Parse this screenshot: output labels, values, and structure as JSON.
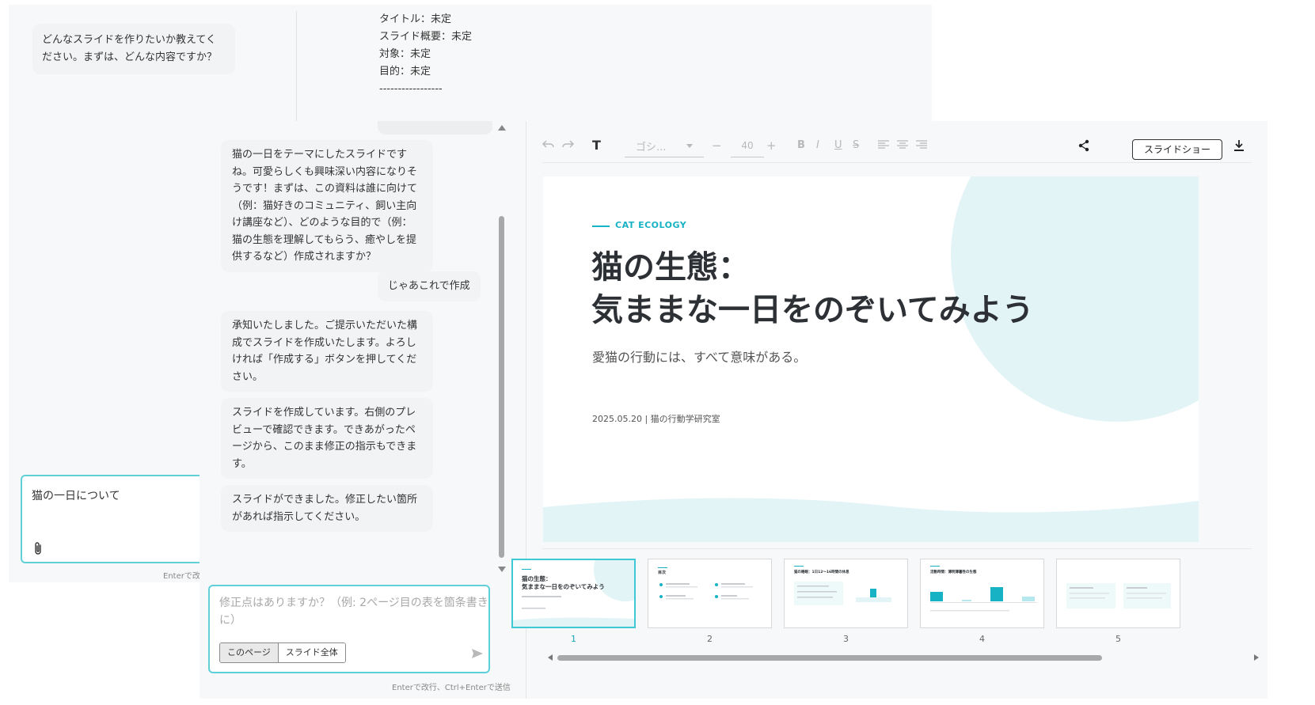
{
  "back_window": {
    "bubble_text": "どんなスライドを作りたいか教えてください。まずは、どんな内容ですか？",
    "info_lines": [
      "タイトル：未定",
      "スライド概要：未定",
      "対象：未定",
      "目的：未定",
      "-----------------"
    ],
    "input_value": "猫の一日について",
    "hint": "Enterで改"
  },
  "chat": {
    "messages": [
      {
        "role": "ai",
        "text": "猫の一日をテーマにしたスライドですね。可愛らしくも興味深い内容になりそうです！まずは、この資料は誰に向けて（例：猫好きのコミュニティ、飼い主向け講座など）、どのような目的で（例：猫の生態を理解してもらう、癒やしを提供するなど）作成されますか？"
      },
      {
        "role": "user",
        "text": "じゃあこれで作成"
      },
      {
        "role": "ai",
        "text": "承知いたしました。ご提示いただいた構成でスライドを作成いたします。よろしければ「作成する」ボタンを押してください。"
      },
      {
        "role": "ai",
        "text": "スライドを作成しています。右側のプレビューで確認できます。できあがったページから、このまま修正の指示もできます。"
      },
      {
        "role": "ai",
        "text": "スライドができました。修正したい箇所があれば指示してください。"
      }
    ],
    "input_placeholder": "修正点はありますか？（例: 2ページ目の表を箇条書きに）",
    "scope_options": [
      "このページ",
      "スライド全体"
    ],
    "scope_selected": "このページ",
    "hint": "Enterで改行、Ctrl+Enterで送信"
  },
  "toolbar": {
    "undo_icon": "undo-icon",
    "redo_icon": "redo-icon",
    "text_icon": "T",
    "font_family_value": "ゴシ...",
    "font_size_minus": "−",
    "font_size_value": "40",
    "font_size_plus": "+",
    "bold": "B",
    "italic": "I",
    "underline": "U",
    "strike": "S",
    "slideshow_label": "スライドショー"
  },
  "slide": {
    "eyebrow": "CAT ECOLOGY",
    "title_line1": "猫の生態：",
    "title_line2": "気ままな一日をのぞいてみよう",
    "subtitle": "愛猫の行動には、すべて意味がある。",
    "meta": "2025.05.20 | 猫の行動学研究室",
    "accent_color": "#17b3c4"
  },
  "thumbnails": [
    {
      "number": "1",
      "title_line1": "猫の生態：",
      "title_line2": "気ままな一日をのぞいてみよう",
      "active": true
    },
    {
      "number": "2",
      "title": "目次"
    },
    {
      "number": "3",
      "title": "猫の睡眠：1日12〜16時間の休息"
    },
    {
      "number": "4",
      "title": "活動時間：薄明薄暮性の生態"
    },
    {
      "number": "5"
    }
  ]
}
